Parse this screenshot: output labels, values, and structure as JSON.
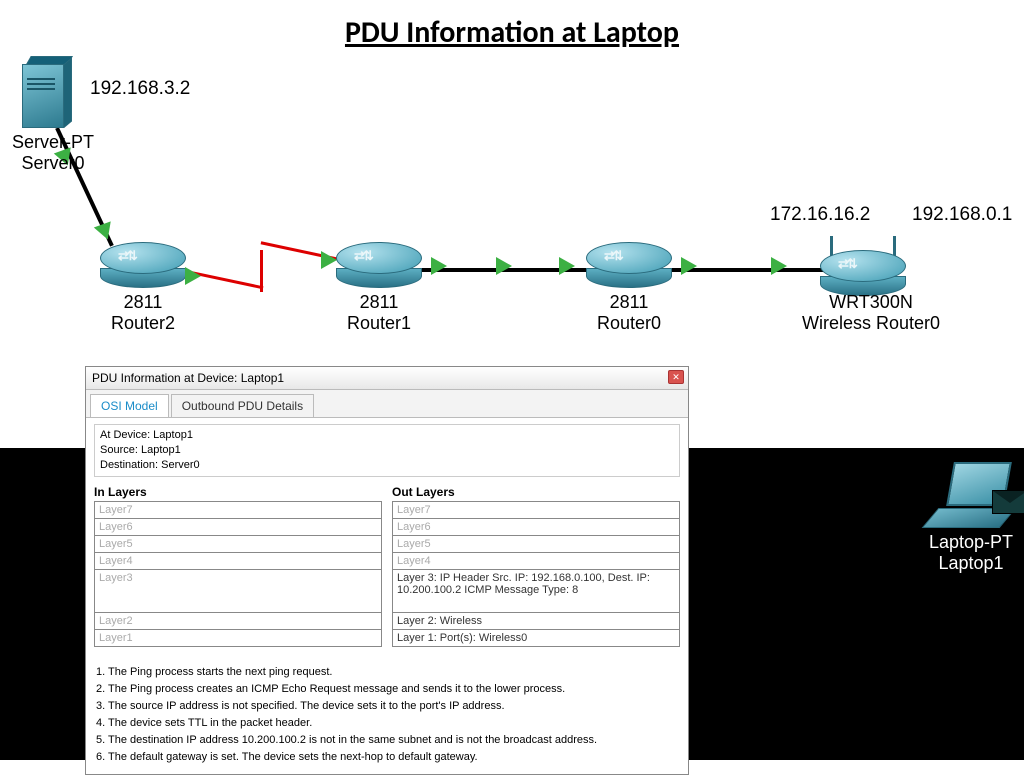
{
  "title": "PDU Information at Laptop",
  "ips": {
    "server": "192.168.3.2",
    "wr_left": "172.16.16.2",
    "wr_right": "192.168.0.1"
  },
  "devices": {
    "server": {
      "type": "Server-PT",
      "name": "Server0"
    },
    "r2": {
      "type": "2811",
      "name": "Router2"
    },
    "r1": {
      "type": "2811",
      "name": "Router1"
    },
    "r0": {
      "type": "2811",
      "name": "Router0"
    },
    "wr": {
      "type": "WRT300N",
      "name": "Wireless Router0"
    },
    "laptop": {
      "type": "Laptop-PT",
      "name": "Laptop1"
    }
  },
  "pdu": {
    "window_title": "PDU Information at Device: Laptop1",
    "tabs": {
      "osi": "OSI Model",
      "out": "Outbound PDU Details"
    },
    "info": {
      "at": "At Device: Laptop1",
      "src": "Source: Laptop1",
      "dst": "Destination: Server0"
    },
    "in_head": "In Layers",
    "out_head": "Out Layers",
    "in_layers": {
      "l7": "Layer7",
      "l6": "Layer6",
      "l5": "Layer5",
      "l4": "Layer4",
      "l3": "Layer3",
      "l2": "Layer2",
      "l1": "Layer1"
    },
    "out_layers": {
      "l7": "Layer7",
      "l6": "Layer6",
      "l5": "Layer5",
      "l4": "Layer4",
      "l3": "Layer 3: IP Header Src. IP: 192.168.0.100, Dest. IP: 10.200.100.2 ICMP Message Type: 8",
      "l2": "Layer 2: Wireless",
      "l1": "Layer 1: Port(s): Wireless0"
    },
    "steps": {
      "s1": "1. The Ping process starts the next ping request.",
      "s2": "2. The Ping process creates an ICMP Echo Request message and sends it to the lower process.",
      "s3": "3. The source IP address is not specified. The device sets it to the port's IP address.",
      "s4": "4. The device sets TTL in the packet header.",
      "s5": "5. The destination IP address 10.200.100.2 is not in the same subnet and is not the broadcast address.",
      "s6": "6. The default gateway is set. The device sets the next-hop to default gateway."
    }
  }
}
